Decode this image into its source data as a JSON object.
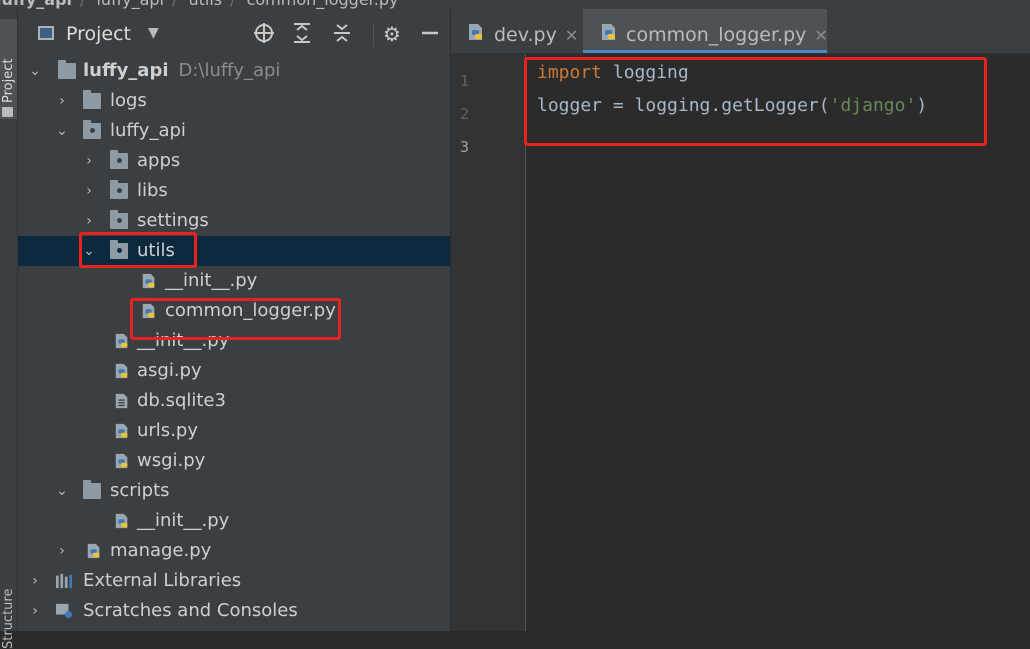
{
  "breadcrumb": {
    "items": [
      "luffy_api",
      "luffy_api",
      "utils",
      "common_logger.py"
    ]
  },
  "toolstrip": {
    "project_tab": "Project",
    "structure_tab": "Structure"
  },
  "project_panel": {
    "title": "Project",
    "tree": [
      {
        "label": "luffy_api",
        "sub": "D:\\luffy_api"
      },
      {
        "label": "logs"
      },
      {
        "label": "luffy_api"
      },
      {
        "label": "apps"
      },
      {
        "label": "libs"
      },
      {
        "label": "settings"
      },
      {
        "label": "utils"
      },
      {
        "label": "__init__.py"
      },
      {
        "label": "common_logger.py"
      },
      {
        "label": "__init__.py"
      },
      {
        "label": "asgi.py"
      },
      {
        "label": "db.sqlite3"
      },
      {
        "label": "urls.py"
      },
      {
        "label": "wsgi.py"
      },
      {
        "label": "scripts"
      },
      {
        "label": "__init__.py"
      },
      {
        "label": "manage.py"
      },
      {
        "label": "External Libraries"
      },
      {
        "label": "Scratches and Consoles"
      }
    ]
  },
  "editor": {
    "tabs": [
      {
        "label": "dev.py",
        "active": false
      },
      {
        "label": "common_logger.py",
        "active": true
      }
    ],
    "line_numbers": [
      "1",
      "2",
      "3"
    ],
    "code": {
      "line1_kw": "import",
      "line1_rest": " logging",
      "line2_a": "logger = logging.getLogger(",
      "line2_str": "'django'",
      "line2_b": ")"
    }
  },
  "colors": {
    "highlight": "#e8231f",
    "selection": "#0d293e",
    "tab_underline": "#4a88c7"
  }
}
